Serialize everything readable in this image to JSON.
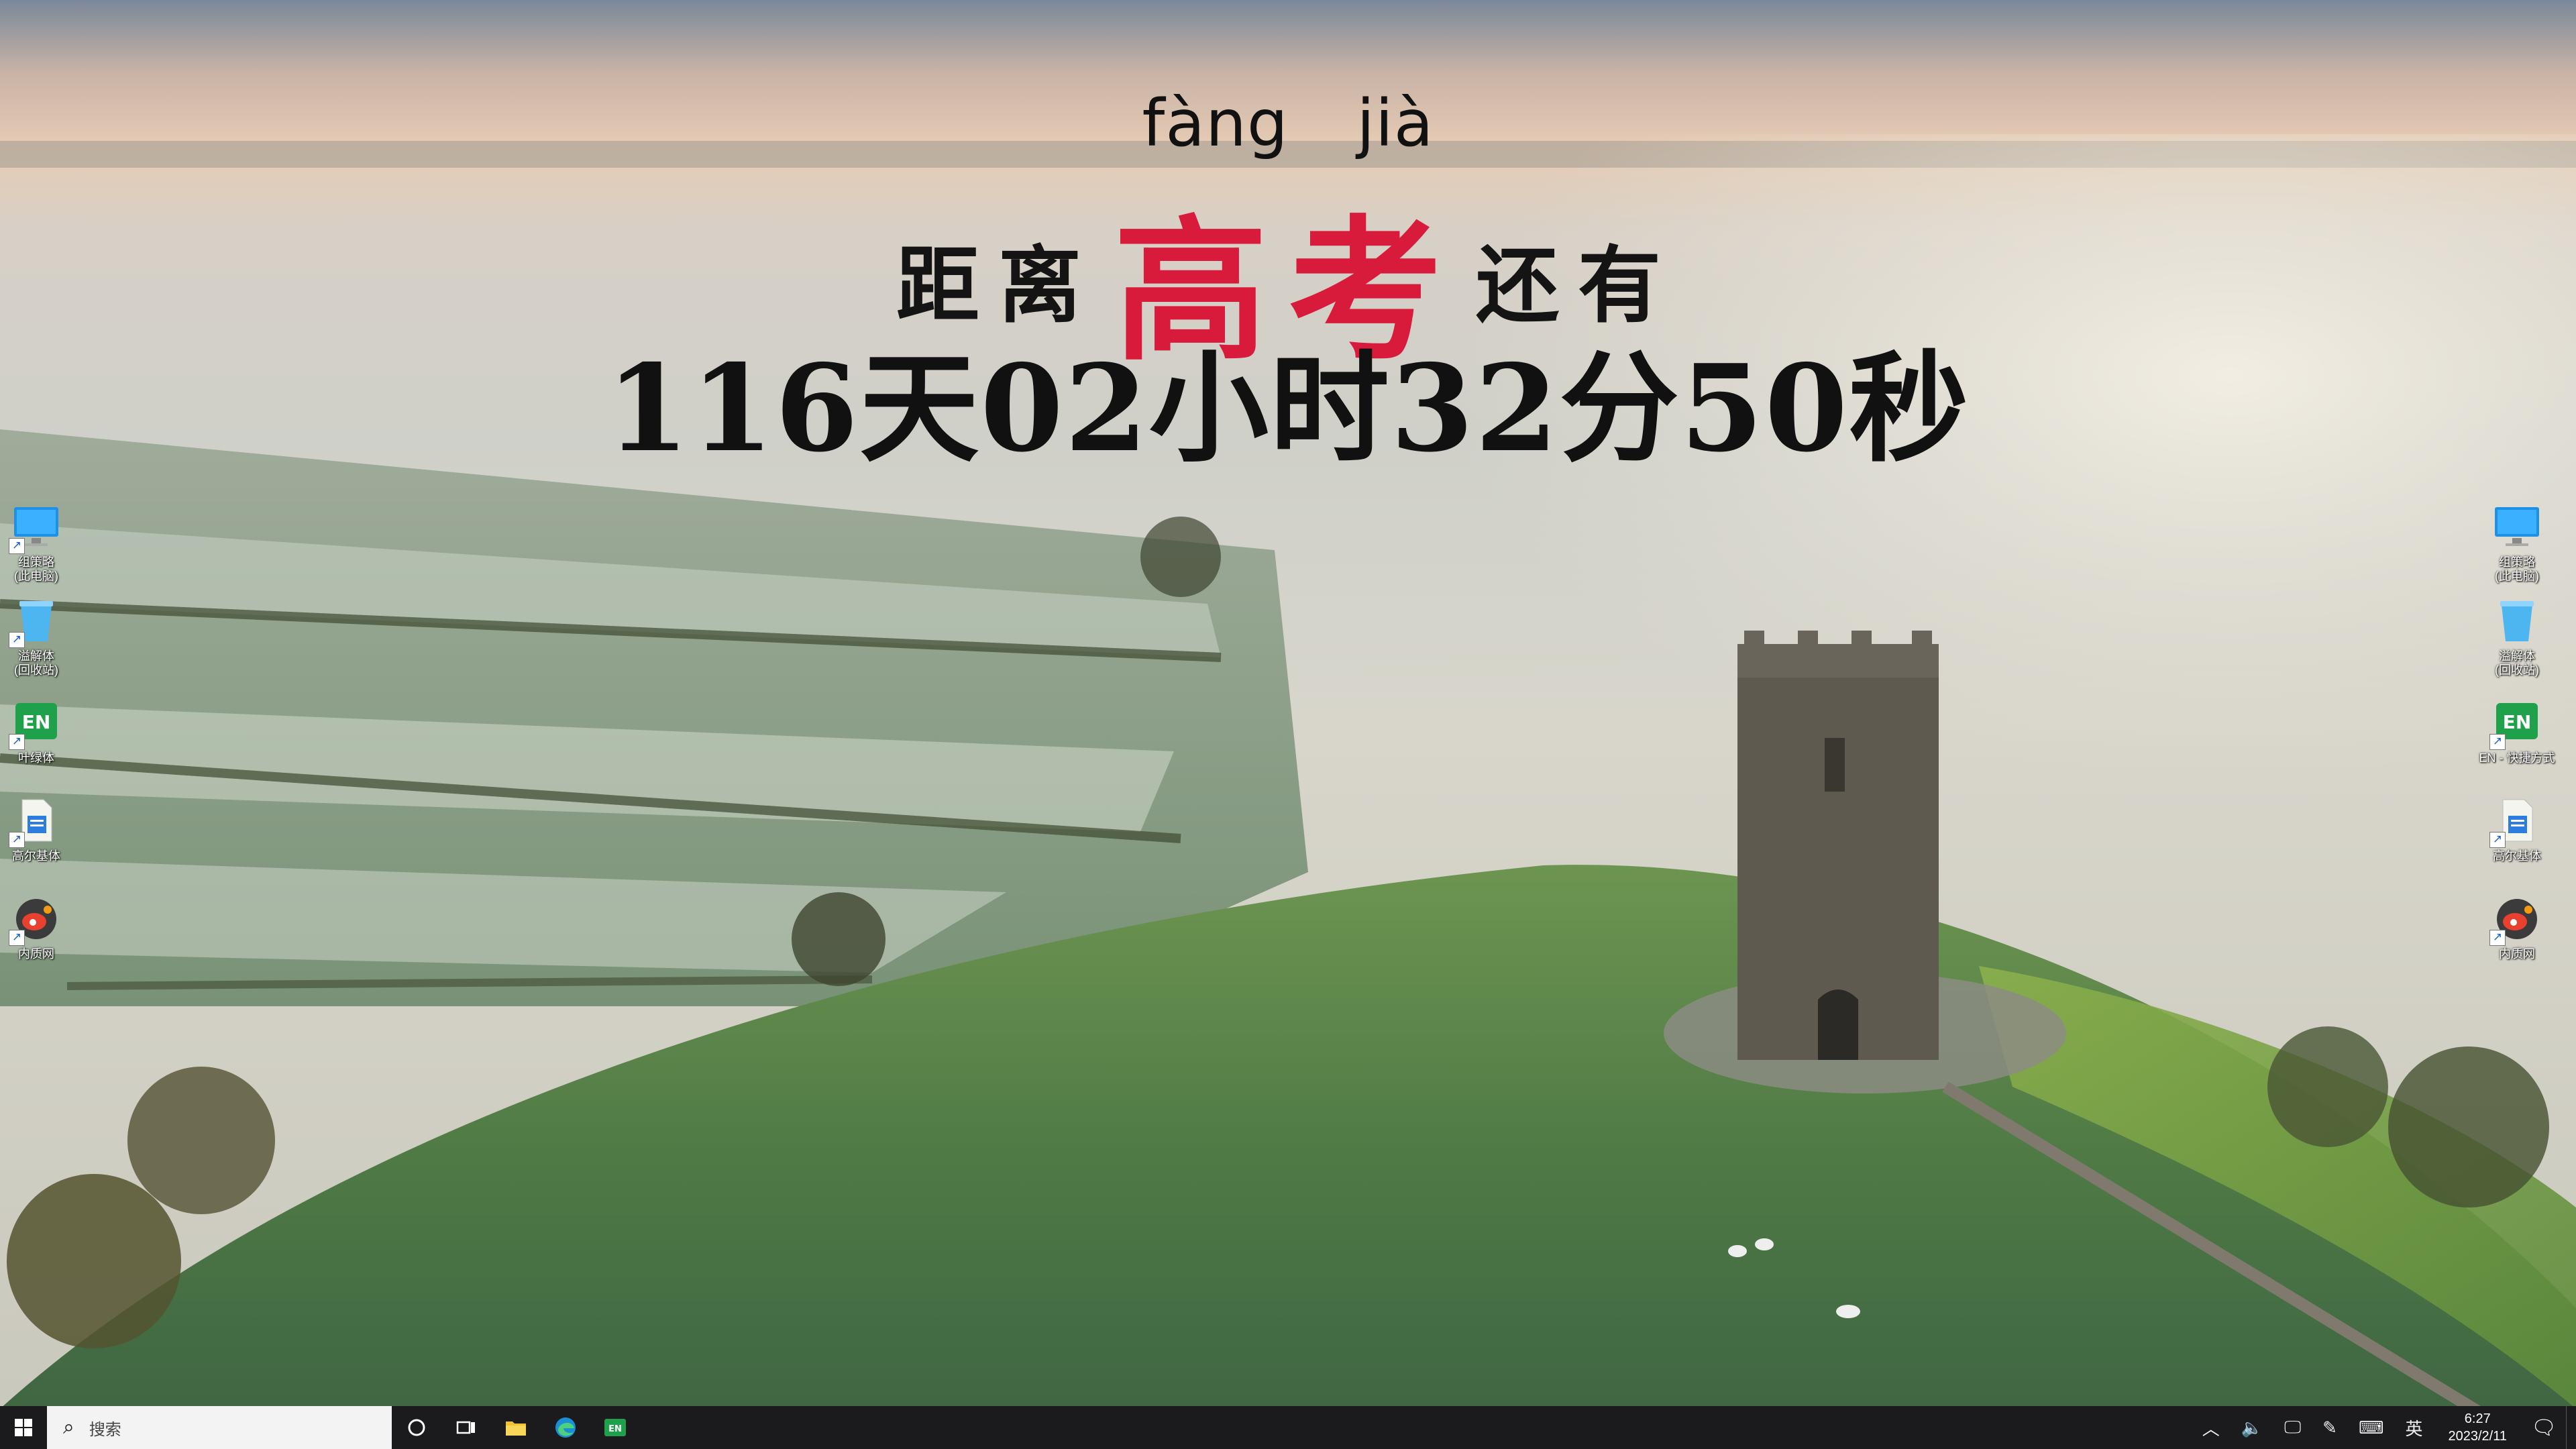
{
  "overlay": {
    "pinyin": "fàng jià",
    "line_left": "距离",
    "line_highlight": "高考",
    "line_right": "还有",
    "countdown": "116天02小时32分50秒"
  },
  "desktop_icons_left": [
    {
      "name": "this-pc-shortcut",
      "label": "组策略\n(此电脑)",
      "icon": "monitor-icon"
    },
    {
      "name": "recycle-bin-shortcut",
      "label": "溢解体\n(回收站)",
      "icon": "recycle-bin-icon"
    },
    {
      "name": "en-app-shortcut",
      "label": "叶绿体",
      "icon": "en-app-icon"
    },
    {
      "name": "document-shortcut",
      "label": "高尔基体",
      "icon": "document-icon"
    },
    {
      "name": "weibo-shortcut",
      "label": "内质网",
      "icon": "weibo-icon"
    }
  ],
  "desktop_icons_right": [
    {
      "name": "this-pc-shortcut-right",
      "label": "组策略\n(此电脑)",
      "icon": "monitor-icon"
    },
    {
      "name": "recycle-bin-shortcut-right",
      "label": "溢解体\n(回收站)",
      "icon": "recycle-bin-icon"
    },
    {
      "name": "en-app-shortcut-right",
      "label": "EN - 快捷方式",
      "icon": "en-app-icon"
    },
    {
      "name": "document-shortcut-right",
      "label": "高尔基体",
      "icon": "document-icon"
    },
    {
      "name": "weibo-shortcut-right",
      "label": "内质网",
      "icon": "weibo-icon"
    }
  ],
  "taskbar": {
    "search_placeholder": "搜索",
    "apps": [
      "cortana-icon",
      "task-view-icon",
      "file-explorer-icon",
      "edge-icon",
      "en-app-icon"
    ],
    "ime": "英",
    "time": "6:27",
    "date": "2023/2/11"
  },
  "colors": {
    "highlight": "#d81b3a",
    "taskbar": "#1b1b1d",
    "en_green": "#1fa04a"
  }
}
